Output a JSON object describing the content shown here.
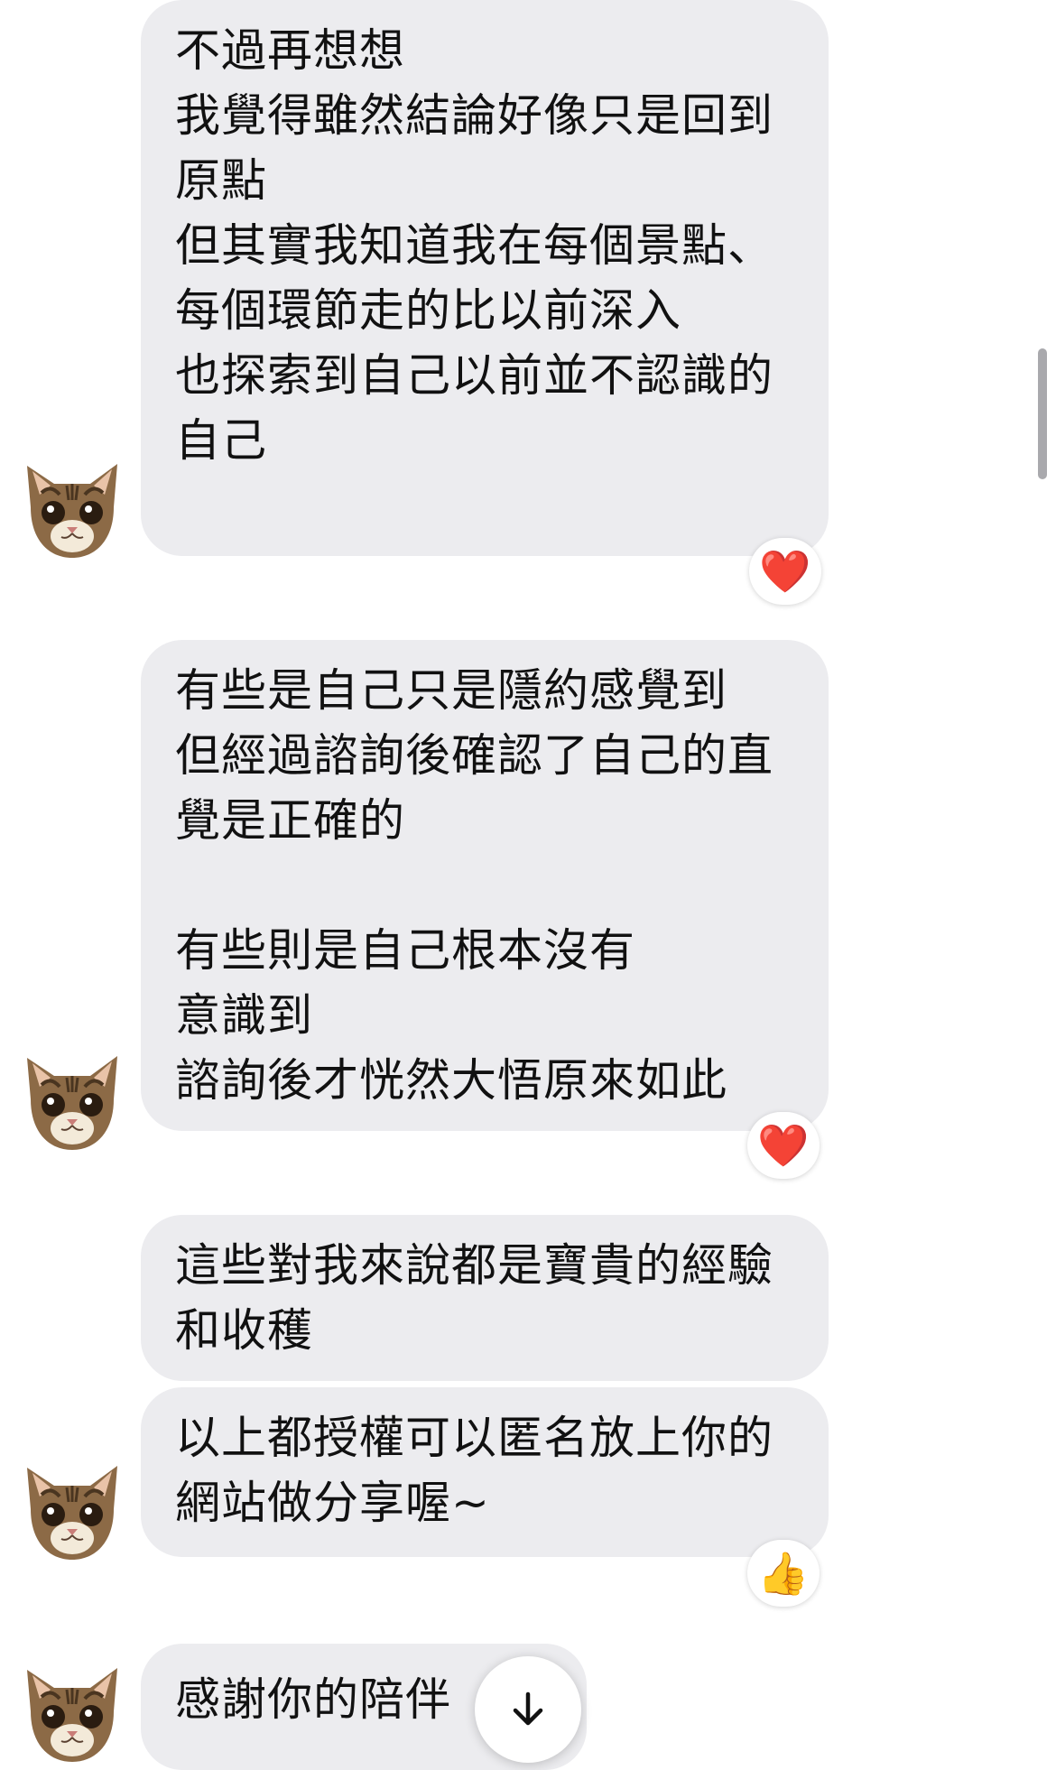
{
  "messages": [
    {
      "text": "不過再想想\n我覺得雖然結論好像只是回到原點\n但其實我知道我在每個景點、每個環節走的比以前深入\n也探索到自己以前並不認識的自己",
      "reaction": "❤️"
    },
    {
      "text": "有些是自己只是隱約感覺到\n但經過諮詢後確認了自己的直覺是正確的\n\n有些則是自己根本沒有\n意識到\n諮詢後才恍然大悟原來如此",
      "reaction": "❤️"
    },
    {
      "text": "這些對我來說都是寶貴的經驗和收穫"
    },
    {
      "text": "以上都授權可以匿名放上你的網站做分享喔~",
      "reaction": "👍"
    },
    {
      "text": "感謝你的陪伴"
    }
  ],
  "colors": {
    "bubble": "#ececef",
    "text": "#111111",
    "background": "#ffffff"
  },
  "icons": {
    "avatar": "cat-face-avatar-icon",
    "scroll": "arrow-down-icon"
  }
}
